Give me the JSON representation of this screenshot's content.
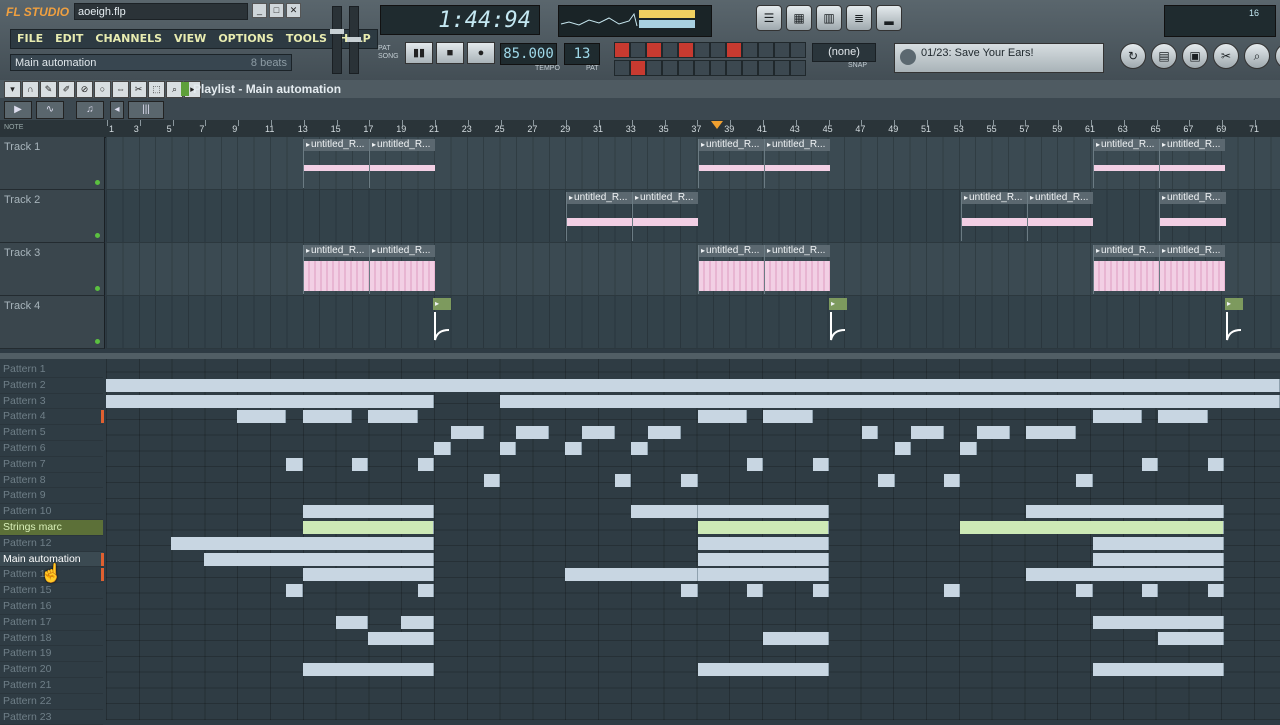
{
  "app": {
    "logo": "FL STUDIO",
    "file_name": "aoeigh.flp"
  },
  "menu": [
    "FILE",
    "EDIT",
    "CHANNELS",
    "VIEW",
    "OPTIONS",
    "TOOLS",
    "HELP"
  ],
  "hint_bar": {
    "text": "Main automation",
    "right": "8 beats"
  },
  "song_time": "1:44:94",
  "transport": {
    "pat_label": "PAT",
    "song_label": "SONG",
    "play": "▮▮",
    "stop": "■",
    "record": "●"
  },
  "tempo": {
    "value": "85.000",
    "label": "TEMPO"
  },
  "pattern": {
    "value": "13",
    "label": "PAT"
  },
  "snap": {
    "value": "(none)",
    "label": "SNAP"
  },
  "news": "01/23: Save Your Ears!",
  "cpu": {
    "value": "16"
  },
  "playlist": {
    "title": "Playlist - Main automation",
    "note_label": "NOTE"
  },
  "ruler": [
    "1",
    "3",
    "5",
    "7",
    "9",
    "11",
    "13",
    "15",
    "17",
    "19",
    "21",
    "23",
    "25",
    "27",
    "29",
    "31",
    "33",
    "35",
    "37",
    "39",
    "41",
    "43",
    "45",
    "47",
    "49",
    "51",
    "53",
    "55",
    "57",
    "59",
    "61",
    "63",
    "65",
    "67",
    "69",
    "71"
  ],
  "tracks": [
    {
      "name": "Track 1"
    },
    {
      "name": "Track 2"
    },
    {
      "name": "Track 3"
    },
    {
      "name": "Track 4"
    }
  ],
  "clip_label": "untitled_R...",
  "colors": {
    "accent": "#f0a030",
    "clip_wave": "#f2cfe4",
    "pattern_block": "#c8d6e2",
    "pattern_green": "#cde9b6"
  },
  "patterns": [
    {
      "name": "Pattern 1"
    },
    {
      "name": "Pattern 2"
    },
    {
      "name": "Pattern 3"
    },
    {
      "name": "Pattern 4"
    },
    {
      "name": "Pattern 5"
    },
    {
      "name": "Pattern 6"
    },
    {
      "name": "Pattern 7"
    },
    {
      "name": "Pattern 8"
    },
    {
      "name": "Pattern 9"
    },
    {
      "name": "Pattern 10"
    },
    {
      "name": "Strings marc"
    },
    {
      "name": "Pattern 12"
    },
    {
      "name": "Main automation"
    },
    {
      "name": "Pattern 14"
    },
    {
      "name": "Pattern 15"
    },
    {
      "name": "Pattern 16"
    },
    {
      "name": "Pattern 17"
    },
    {
      "name": "Pattern 18"
    },
    {
      "name": "Pattern 19"
    },
    {
      "name": "Pattern 20"
    },
    {
      "name": "Pattern 21"
    },
    {
      "name": "Pattern 22"
    },
    {
      "name": "Pattern 23"
    }
  ]
}
